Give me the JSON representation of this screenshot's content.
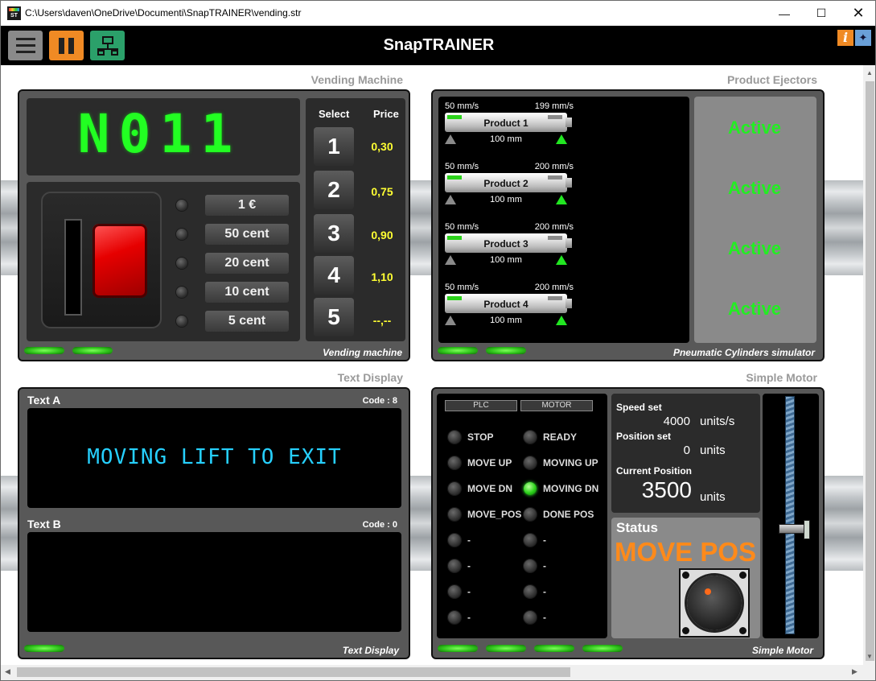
{
  "window": {
    "path": "C:\\Users\\daven\\OneDrive\\Documenti\\SnapTRAINER\\vending.str",
    "icon_text": "ST",
    "min_glyph": "—",
    "max_glyph": "☐",
    "close_glyph": "✕"
  },
  "app": {
    "title": "SnapTRAINER",
    "info_glyph": "i",
    "pin_glyph": "✦"
  },
  "vending": {
    "title": "Vending Machine",
    "footer": "Vending machine",
    "display_chars": [
      "N",
      "0",
      "1",
      "1"
    ],
    "coins": [
      "1 €",
      "50 cent",
      "20 cent",
      "10 cent",
      "5 cent"
    ],
    "select_header": "Select",
    "price_header": "Price",
    "selections": [
      "1",
      "2",
      "3",
      "4",
      "5"
    ],
    "prices": [
      "0,30",
      "0,75",
      "0,90",
      "1,10",
      "--,--"
    ]
  },
  "ejectors": {
    "title": "Product Ejectors",
    "footer": "Pneumatic Cylinders simulator",
    "cylinders": [
      {
        "min": "50 mm/s",
        "max": "199 mm/s",
        "label": "Product 1",
        "stroke": "100 mm",
        "state": "Active"
      },
      {
        "min": "50 mm/s",
        "max": "200 mm/s",
        "label": "Product 2",
        "stroke": "100 mm",
        "state": "Active"
      },
      {
        "min": "50 mm/s",
        "max": "200 mm/s",
        "label": "Product 3",
        "stroke": "100 mm",
        "state": "Active"
      },
      {
        "min": "50 mm/s",
        "max": "200 mm/s",
        "label": "Product 4",
        "stroke": "100 mm",
        "state": "Active"
      }
    ]
  },
  "text_display": {
    "title": "Text Display",
    "footer": "Text Display",
    "a_label": "Text A",
    "a_code": "Code : 8",
    "a_text": "MOVING LIFT TO EXIT",
    "b_label": "Text B",
    "b_code": "Code : 0",
    "b_text": ""
  },
  "motor": {
    "title": "Simple Motor",
    "footer": "Simple Motor",
    "plc_header": "PLC",
    "motor_header": "MOTOR",
    "plc_signals": [
      "STOP",
      "MOVE UP",
      "MOVE DN",
      "MOVE_POS",
      "-",
      "-",
      "-",
      "-"
    ],
    "motor_signals": [
      "READY",
      "MOVING UP",
      "MOVING DN",
      "DONE POS",
      "-",
      "-",
      "-",
      "-"
    ],
    "motor_signal_on": [
      false,
      false,
      true,
      false,
      false,
      false,
      false,
      false
    ],
    "speed_label": "Speed set",
    "speed_value": "4000",
    "speed_unit": "units/s",
    "position_label": "Position set",
    "position_value": "0",
    "position_unit": "units",
    "current_label": "Current Position",
    "current_value": "3500",
    "current_unit": "units",
    "status_label": "Status",
    "status_value": "MOVE POS"
  }
}
